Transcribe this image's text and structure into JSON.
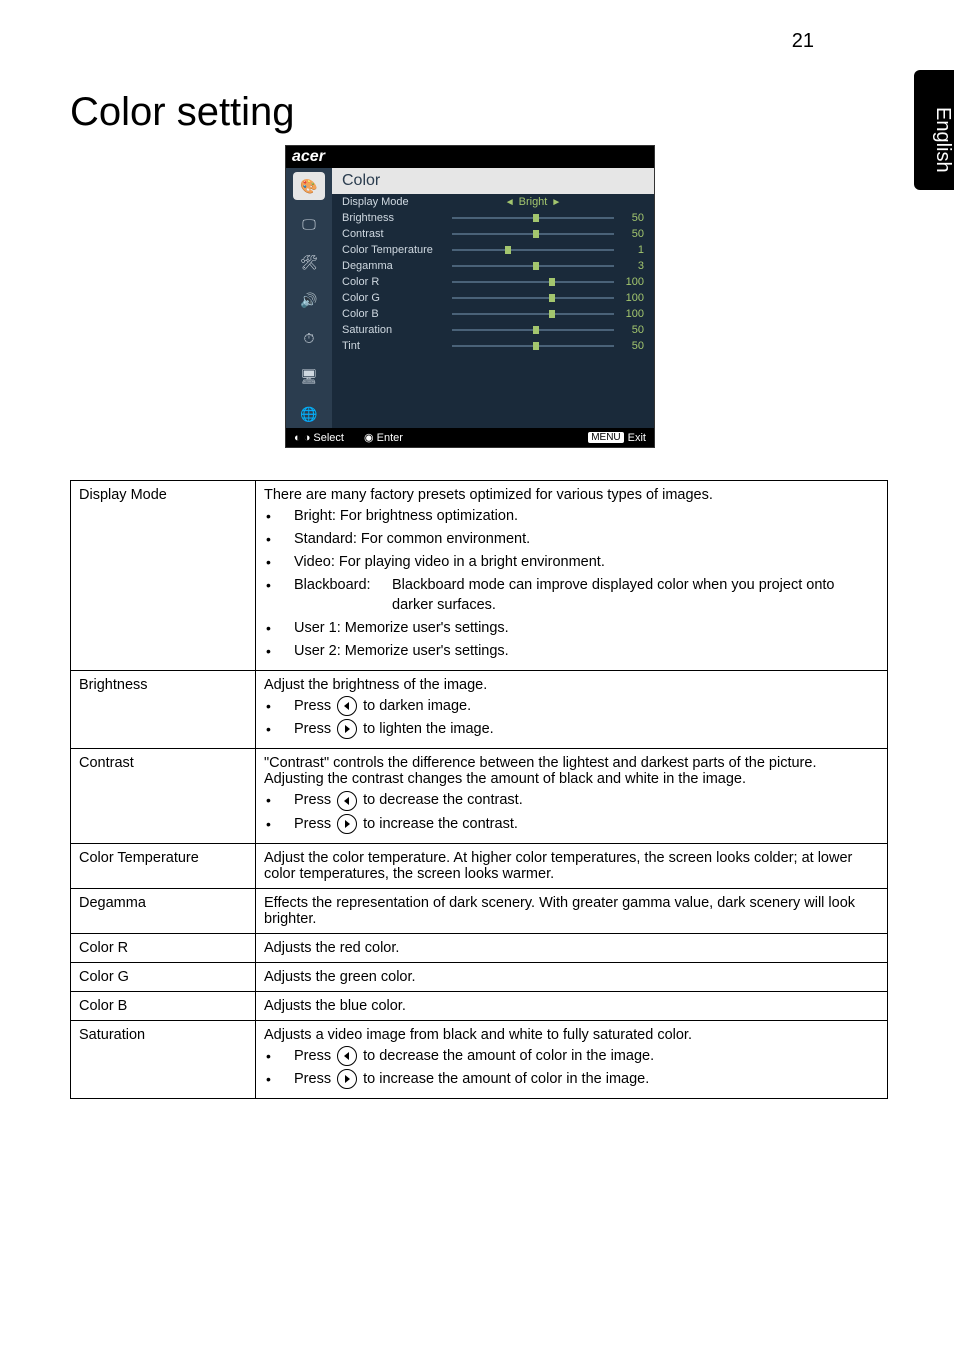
{
  "page_number": "21",
  "side_tab": "English",
  "heading": "Color setting",
  "osd": {
    "logo": "acer",
    "panel_title": "Color",
    "rows": {
      "display_mode": {
        "label": "Display Mode",
        "value": "Bright"
      },
      "brightness": {
        "label": "Brightness",
        "value": "50"
      },
      "contrast": {
        "label": "Contrast",
        "value": "50"
      },
      "color_temp": {
        "label": "Color Temperature",
        "value": "1"
      },
      "degamma": {
        "label": "Degamma",
        "value": "3"
      },
      "color_r": {
        "label": "Color R",
        "value": "100"
      },
      "color_g": {
        "label": "Color G",
        "value": "100"
      },
      "color_b": {
        "label": "Color B",
        "value": "100"
      },
      "saturation": {
        "label": "Saturation",
        "value": "50"
      },
      "tint": {
        "label": "Tint",
        "value": "50"
      }
    },
    "footer": {
      "select": "Select",
      "enter": "Enter",
      "menu": "MENU",
      "exit": "Exit"
    }
  },
  "table": {
    "display_mode": {
      "label": "Display Mode",
      "intro": "There are many factory presets optimized for various types of images.",
      "b1": "Bright: For brightness optimization.",
      "b2": "Standard: For common environment.",
      "b3": "Video: For playing video in a bright environment.",
      "b4_term": "Blackboard:",
      "b4_def": "Blackboard mode can improve displayed color when you project onto darker surfaces.",
      "b5": "User 1: Memorize user's settings.",
      "b6": "User 2: Memorize user's settings."
    },
    "brightness": {
      "label": "Brightness",
      "intro": "Adjust the brightness of the image.",
      "b1a": "Press ",
      "b1b": " to darken image.",
      "b2a": "Press ",
      "b2b": " to lighten the image."
    },
    "contrast": {
      "label": "Contrast",
      "intro": "\"Contrast\" controls the difference between the lightest and darkest parts of the picture. Adjusting the contrast changes the amount of black and white in the image.",
      "b1a": "Press ",
      "b1b": " to decrease the contrast.",
      "b2a": "Press ",
      "b2b": " to increase the contrast."
    },
    "color_temp": {
      "label": "Color Temperature",
      "desc": "Adjust the color temperature. At higher color temperatures, the screen looks colder; at lower color temperatures, the screen looks warmer."
    },
    "degamma": {
      "label": "Degamma",
      "desc": "Effects the representation of dark scenery. With greater gamma value, dark scenery will look brighter."
    },
    "color_r": {
      "label": "Color R",
      "desc": "Adjusts the red color."
    },
    "color_g": {
      "label": "Color G",
      "desc": "Adjusts the green color."
    },
    "color_b": {
      "label": "Color B",
      "desc": "Adjusts the blue color."
    },
    "saturation": {
      "label": "Saturation",
      "intro": "Adjusts a video image from black and white to fully saturated color.",
      "b1a": "Press ",
      "b1b": " to decrease the amount of color in the image.",
      "b2a": "Press ",
      "b2b": " to increase the amount of color in the image."
    }
  }
}
